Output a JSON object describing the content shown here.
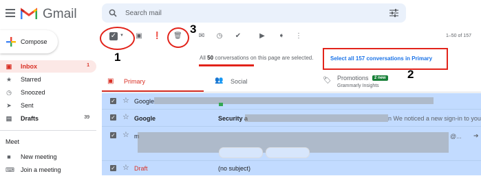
{
  "app": {
    "name": "Gmail"
  },
  "search": {
    "placeholder": "Search mail"
  },
  "compose": {
    "label": "Compose"
  },
  "nav": [
    {
      "label": "Inbox",
      "count": "1"
    },
    {
      "label": "Starred",
      "count": ""
    },
    {
      "label": "Snoozed",
      "count": ""
    },
    {
      "label": "Sent",
      "count": ""
    },
    {
      "label": "Drafts",
      "count": "39"
    }
  ],
  "meet": {
    "title": "Meet",
    "items": [
      "New meeting",
      "Join a meeting"
    ]
  },
  "toolbar": {
    "pager": "1–50 of 157"
  },
  "annotations": {
    "one": "1",
    "two": "2",
    "three": "3"
  },
  "selection": {
    "prefix": "All ",
    "count": "50",
    "suffix": " conversations on this page are selected.",
    "select_all": "Select all 157 conversations in Primary"
  },
  "tabs": [
    {
      "label": "Primary"
    },
    {
      "label": "Social"
    },
    {
      "label": "Promotions",
      "badge": "2 new",
      "sub": "Grammarly Insights"
    }
  ],
  "rows": [
    {
      "sender": "Google",
      "subject": ""
    },
    {
      "sender": "Google",
      "subject": "Security a",
      "snippet": "n We noticed a new sign-in to your"
    },
    {
      "sender": "m",
      "subject": "",
      "snippet": "@..."
    },
    {
      "sender": "Draft",
      "subject": "(no subject)"
    }
  ],
  "colors": {
    "accent": "#d93025",
    "selection": "#c2dbff",
    "annotation": "#e2231a",
    "link": "#1a73e8"
  }
}
